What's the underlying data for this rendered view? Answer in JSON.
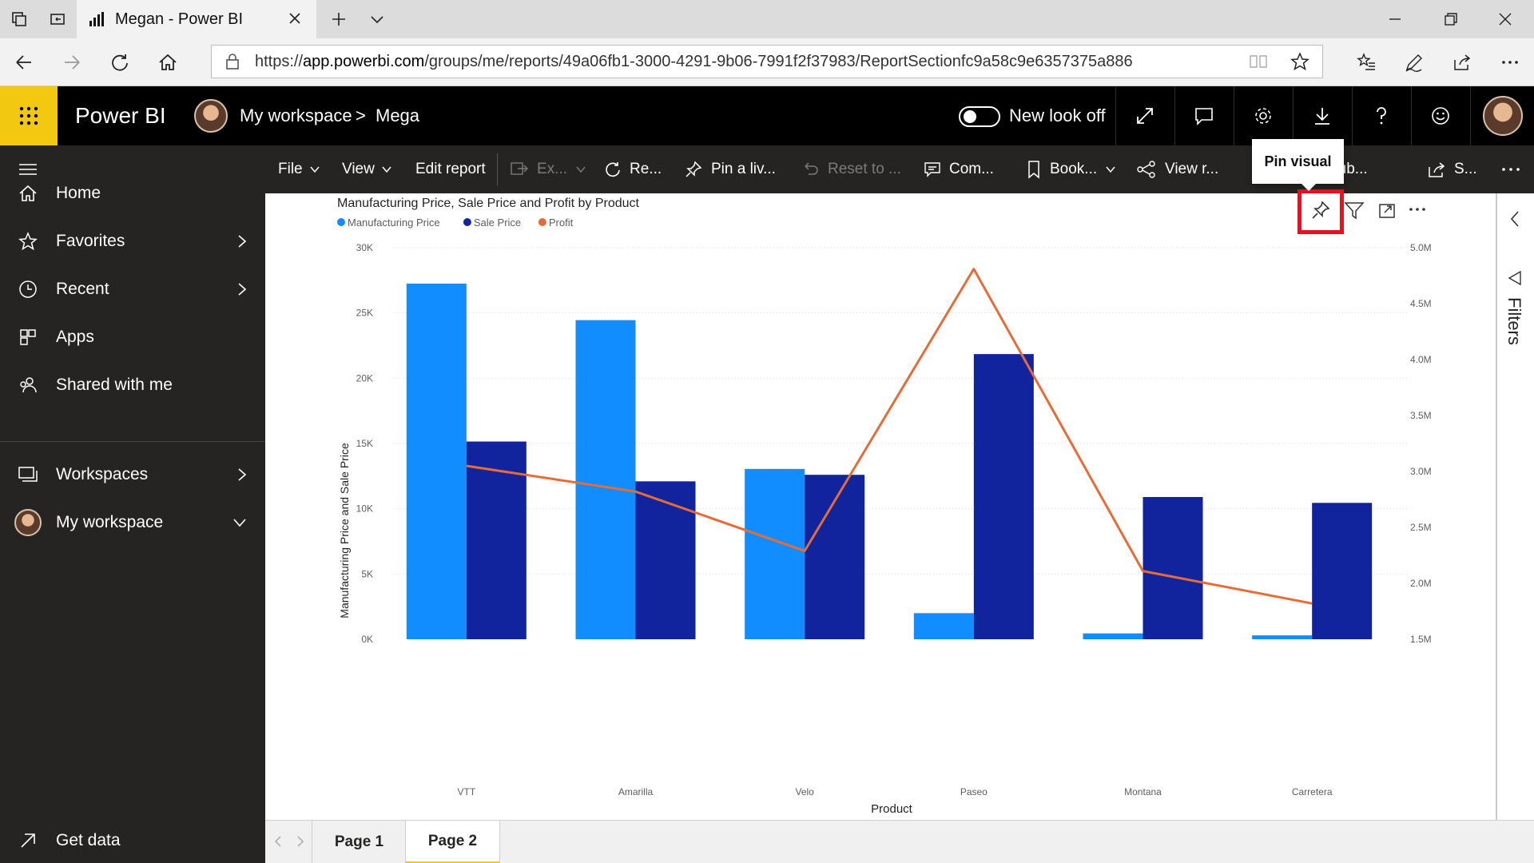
{
  "browser": {
    "tab_title": "Megan - Power BI",
    "url_prefix": "https://",
    "url_host": "app.powerbi.com",
    "url_path": "/groups/me/reports/49a06fb1-3000-4291-9b06-7991f2f37983/ReportSectionfc9a58c9e6357375a886"
  },
  "header": {
    "brand": "Power BI",
    "workspace": "My workspace",
    "separator": ">",
    "report": "Mega",
    "new_look": "New look off"
  },
  "nav": {
    "home": "Home",
    "favorites": "Favorites",
    "recent": "Recent",
    "apps": "Apps",
    "shared": "Shared with me",
    "workspaces": "Workspaces",
    "my_workspace": "My workspace",
    "get_data": "Get data"
  },
  "ribbon": {
    "file": "File",
    "view": "View",
    "edit_report": "Edit report",
    "export": "Ex...",
    "refresh": "Re...",
    "pin_live": "Pin a liv...",
    "reset": "Reset to ...",
    "comments": "Com...",
    "bookmarks": "Book...",
    "view_related": "View r...",
    "subscribe": "Sub...",
    "share": "S..."
  },
  "tooltip": "Pin visual",
  "filters_label": "Filters",
  "pages": [
    "Page 1",
    "Page 2"
  ],
  "colors": {
    "manufacturing": "#118DFF",
    "sale": "#12239E",
    "profit": "#E66C37",
    "powerbi_yellow": "#F2C811",
    "highlight": "#E81123"
  },
  "chart_data": {
    "type": "bar",
    "title": "Manufacturing Price, Sale Price and Profit by Product",
    "xlabel": "Product",
    "ylabel": "Manufacturing Price and Sale Price",
    "categories": [
      "VTT",
      "Amarilla",
      "Velo",
      "Paseo",
      "Montana",
      "Carretera"
    ],
    "ylim": [
      0,
      30000
    ],
    "y_ticks": [
      "0K",
      "5K",
      "10K",
      "15K",
      "20K",
      "25K",
      "30K"
    ],
    "y2lim": [
      1500000,
      5000000
    ],
    "y2_ticks": [
      "1.5M",
      "2.0M",
      "2.5M",
      "3.0M",
      "3.5M",
      "4.0M",
      "4.5M",
      "5.0M"
    ],
    "legend": "top-left",
    "grid": true,
    "series": [
      {
        "name": "Manufacturing Price",
        "type": "bar",
        "axis": "left",
        "values": [
          27250,
          24450,
          13050,
          2000,
          450,
          300
        ]
      },
      {
        "name": "Sale Price",
        "type": "bar",
        "axis": "left",
        "values": [
          15150,
          12100,
          12600,
          21850,
          10900,
          10450
        ]
      },
      {
        "name": "Profit",
        "type": "line",
        "axis": "right",
        "values": [
          3050000,
          2820000,
          2290000,
          4810000,
          2110000,
          1820000
        ]
      }
    ]
  }
}
